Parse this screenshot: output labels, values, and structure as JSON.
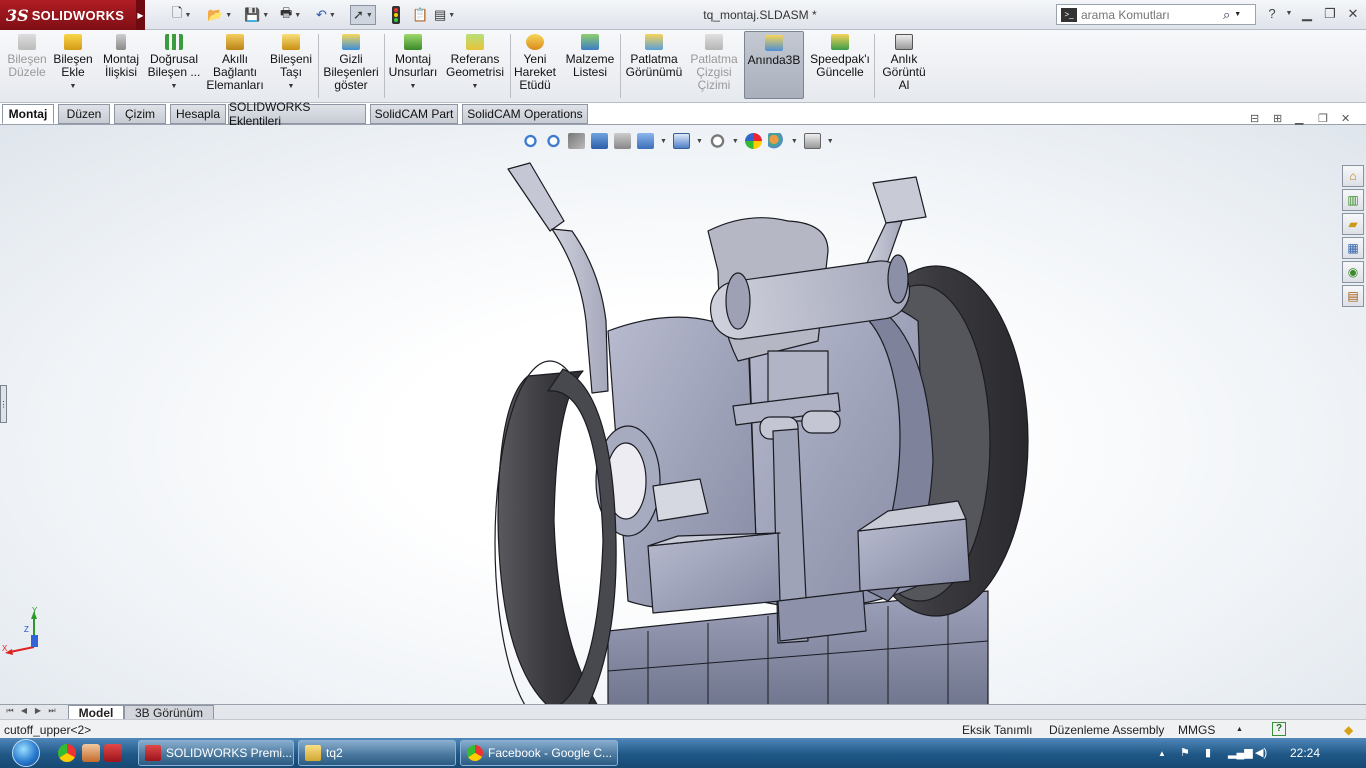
{
  "app": {
    "logo_mark": "3S",
    "logo_text": "SOLIDWORKS",
    "document_title": "tq_montaj.SLDASM *"
  },
  "search": {
    "placeholder": "arama Komutları"
  },
  "toolbar": [
    {
      "label": "Bileşen\nDüzele",
      "disabled": true
    },
    {
      "label": "Bileşen\nEkle"
    },
    {
      "label": "Montaj\nİlişkisi"
    },
    {
      "label": "Doğrusal\nBileşen ..."
    },
    {
      "label": "Akıllı\nBağlantı\nElemanları"
    },
    {
      "label": "Bileşeni\nTaşı"
    },
    {
      "label": "Gizli\nBileşenleri\ngöster"
    },
    {
      "label": "Montaj\nUnsurları"
    },
    {
      "label": "Referans\nGeometrisi"
    },
    {
      "label": "Yeni\nHareket\nEtüdü"
    },
    {
      "label": "Malzeme\nListesi"
    },
    {
      "label": "Patlatma\nGörünümü"
    },
    {
      "label": "Patlatma\nÇizgisi\nÇizimi",
      "disabled": true
    },
    {
      "label": "Anında3B",
      "active": true
    },
    {
      "label": "Speedpak'ı\nGüncelle"
    },
    {
      "label": "Anlık\nGörüntü\nAl"
    }
  ],
  "tabs": [
    "Montaj",
    "Düzen",
    "Çizim",
    "Hesapla",
    "SOLIDWORKS Eklentileri",
    "SolidCAM Part",
    "SolidCAM Operations"
  ],
  "active_tab": "Montaj",
  "bottom_tabs": [
    "Model",
    "3B Görünüm"
  ],
  "triad": {
    "y": "Y",
    "z": "Z",
    "x": "X"
  },
  "status": {
    "selection": "cutoff_upper<2>",
    "definition": "Eksik Tanımlı",
    "mode": "Düzenleme Assembly",
    "units": "MMGS",
    "help": "?"
  },
  "taskbar": {
    "tasks": [
      "SOLIDWORKS Premi...",
      "tq2",
      "Facebook - Google C..."
    ],
    "clock": "22:24"
  },
  "colors": {
    "brand_red": "#9a141b",
    "model_steel": "#9a9db5",
    "wheel": "#4a4a4e"
  }
}
